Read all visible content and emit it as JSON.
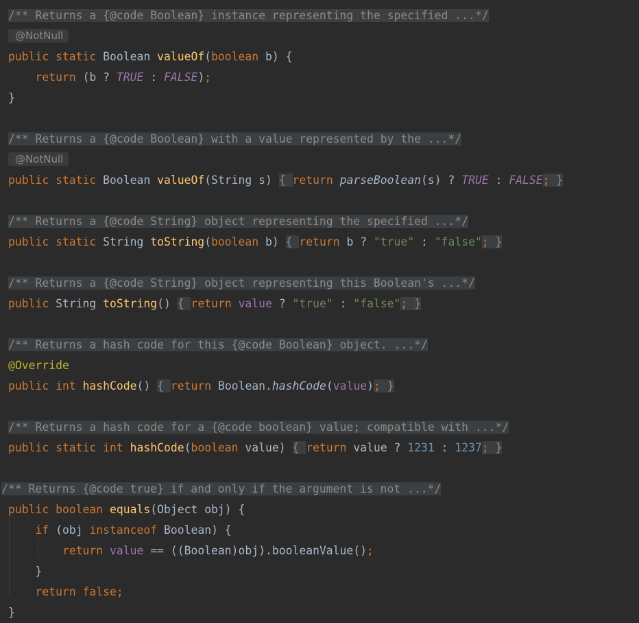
{
  "editor": {
    "lines": [
      {
        "tokens": [
          {
            "c": "fold-comment",
            "t": "/** Returns a {@code Boolean} instance representing the specified ...*/"
          }
        ]
      },
      {
        "inlay": "@NotNull"
      },
      {
        "tokens": [
          {
            "c": "t-kw",
            "t": "public static "
          },
          {
            "c": "t-pl",
            "t": "Boolean "
          },
          {
            "c": "t-fn",
            "t": "valueOf"
          },
          {
            "c": "t-pl",
            "t": "("
          },
          {
            "c": "t-kw",
            "t": "boolean "
          },
          {
            "c": "t-pl",
            "t": "b) {"
          }
        ]
      },
      {
        "tokens": [
          {
            "c": "t-pl",
            "t": "    "
          },
          {
            "c": "t-kw",
            "t": "return "
          },
          {
            "c": "t-pl",
            "t": "(b ? "
          },
          {
            "c": "t-sfld",
            "t": "TRUE"
          },
          {
            "c": "t-pl",
            "t": " : "
          },
          {
            "c": "t-sfld",
            "t": "FALSE"
          },
          {
            "c": "t-pl",
            "t": ")"
          },
          {
            "c": "t-semi",
            "t": ";"
          }
        ]
      },
      {
        "tokens": [
          {
            "c": "t-pl",
            "t": "}"
          }
        ]
      },
      {
        "tokens": []
      },
      {
        "tokens": [
          {
            "c": "fold-comment",
            "t": "/** Returns a {@code Boolean} with a value represented by the ...*/"
          }
        ]
      },
      {
        "inlay": "@NotNull"
      },
      {
        "tokens": [
          {
            "c": "t-kw",
            "t": "public static "
          },
          {
            "c": "t-pl",
            "t": "Boolean "
          },
          {
            "c": "t-fn",
            "t": "valueOf"
          },
          {
            "c": "t-pl",
            "t": "(String s)"
          },
          {
            "c": "t-pl",
            "t": " "
          },
          {
            "c": "fold",
            "t": "{ "
          },
          {
            "c": "t-kw",
            "t": "return "
          },
          {
            "c": "t-sfn",
            "t": "parseBoolean"
          },
          {
            "c": "t-pl",
            "t": "(s) ? "
          },
          {
            "c": "t-sfld",
            "t": "TRUE"
          },
          {
            "c": "t-pl",
            "t": " : "
          },
          {
            "c": "t-sfld",
            "t": "FALSE"
          },
          {
            "c": "fold-semi",
            "t": ";"
          },
          {
            "c": "fold",
            "t": " }"
          }
        ]
      },
      {
        "tokens": []
      },
      {
        "tokens": [
          {
            "c": "fold-comment",
            "t": "/** Returns a {@code String} object representing the specified ...*/"
          }
        ]
      },
      {
        "tokens": [
          {
            "c": "t-kw",
            "t": "public static "
          },
          {
            "c": "t-pl",
            "t": "String "
          },
          {
            "c": "t-fn",
            "t": "toString"
          },
          {
            "c": "t-pl",
            "t": "("
          },
          {
            "c": "t-kw",
            "t": "boolean "
          },
          {
            "c": "t-pl",
            "t": "b)"
          },
          {
            "c": "t-pl",
            "t": " "
          },
          {
            "c": "fold",
            "t": "{ "
          },
          {
            "c": "t-kw",
            "t": "return "
          },
          {
            "c": "t-pl",
            "t": "b ? "
          },
          {
            "c": "t-str",
            "t": "\"true\""
          },
          {
            "c": "t-pl",
            "t": " : "
          },
          {
            "c": "t-str",
            "t": "\"false\""
          },
          {
            "c": "fold-semi",
            "t": ";"
          },
          {
            "c": "fold",
            "t": " }"
          }
        ]
      },
      {
        "tokens": []
      },
      {
        "tokens": [
          {
            "c": "fold-comment",
            "t": "/** Returns a {@code String} object representing this Boolean's ...*/"
          }
        ]
      },
      {
        "tokens": [
          {
            "c": "t-kw",
            "t": "public "
          },
          {
            "c": "t-pl",
            "t": "String "
          },
          {
            "c": "t-fn",
            "t": "toString"
          },
          {
            "c": "t-pl",
            "t": "()"
          },
          {
            "c": "t-pl",
            "t": " "
          },
          {
            "c": "fold",
            "t": "{ "
          },
          {
            "c": "t-kw",
            "t": "return "
          },
          {
            "c": "t-fld",
            "t": "value"
          },
          {
            "c": "t-pl",
            "t": " ? "
          },
          {
            "c": "t-str",
            "t": "\"true\""
          },
          {
            "c": "t-pl",
            "t": " : "
          },
          {
            "c": "t-str",
            "t": "\"false\""
          },
          {
            "c": "fold-semi",
            "t": ";"
          },
          {
            "c": "fold",
            "t": " }"
          }
        ]
      },
      {
        "tokens": []
      },
      {
        "tokens": [
          {
            "c": "fold-comment",
            "t": "/** Returns a hash code for this {@code Boolean} object. ...*/"
          }
        ]
      },
      {
        "tokens": [
          {
            "c": "t-ann",
            "t": "@Override"
          }
        ]
      },
      {
        "tokens": [
          {
            "c": "t-kw",
            "t": "public int "
          },
          {
            "c": "t-fn",
            "t": "hashCode"
          },
          {
            "c": "t-pl",
            "t": "()"
          },
          {
            "c": "t-pl",
            "t": " "
          },
          {
            "c": "fold",
            "t": "{ "
          },
          {
            "c": "t-kw",
            "t": "return "
          },
          {
            "c": "t-pl",
            "t": "Boolean."
          },
          {
            "c": "t-sfn",
            "t": "hashCode"
          },
          {
            "c": "t-pl",
            "t": "("
          },
          {
            "c": "t-fld",
            "t": "value"
          },
          {
            "c": "t-pl",
            "t": ")"
          },
          {
            "c": "fold-semi",
            "t": ";"
          },
          {
            "c": "fold",
            "t": " }"
          }
        ]
      },
      {
        "tokens": []
      },
      {
        "tokens": [
          {
            "c": "fold-comment",
            "t": "/** Returns a hash code for a {@code boolean} value; compatible with ...*/"
          }
        ]
      },
      {
        "tokens": [
          {
            "c": "t-kw",
            "t": "public static int "
          },
          {
            "c": "t-fn",
            "t": "hashCode"
          },
          {
            "c": "t-pl",
            "t": "("
          },
          {
            "c": "t-kw",
            "t": "boolean "
          },
          {
            "c": "t-pl",
            "t": "value)"
          },
          {
            "c": "t-pl",
            "t": " "
          },
          {
            "c": "fold",
            "t": "{ "
          },
          {
            "c": "t-kw",
            "t": "return "
          },
          {
            "c": "t-pl",
            "t": "value ? "
          },
          {
            "c": "t-num",
            "t": "1231"
          },
          {
            "c": "t-pl",
            "t": " : "
          },
          {
            "c": "t-num",
            "t": "1237"
          },
          {
            "c": "fold-semi",
            "t": ";"
          },
          {
            "c": "fold",
            "t": " }"
          }
        ]
      },
      {
        "tokens": []
      },
      {
        "outdent": true,
        "tokens": [
          {
            "c": "fold-comment",
            "t": "/** Returns {@code true} if and only if the argument is not ...*/"
          }
        ]
      },
      {
        "tokens": [
          {
            "c": "t-kw",
            "t": "public boolean "
          },
          {
            "c": "t-fn",
            "t": "equals"
          },
          {
            "c": "t-pl",
            "t": "(Object obj) {"
          }
        ]
      },
      {
        "tokens": [
          {
            "c": "t-pl",
            "t": "    "
          },
          {
            "c": "t-kw",
            "t": "if "
          },
          {
            "c": "t-pl",
            "t": "(obj "
          },
          {
            "c": "t-kw",
            "t": "instanceof "
          },
          {
            "c": "t-pl",
            "t": "Boolean) {"
          }
        ]
      },
      {
        "tokens": [
          {
            "c": "t-pl",
            "t": "        "
          },
          {
            "c": "t-kw",
            "t": "return "
          },
          {
            "c": "t-fld",
            "t": "value"
          },
          {
            "c": "t-pl",
            "t": " == ((Boolean)obj).booleanValue()"
          },
          {
            "c": "t-semi",
            "t": ";"
          }
        ]
      },
      {
        "tokens": [
          {
            "c": "t-pl",
            "t": "    }"
          }
        ]
      },
      {
        "tokens": [
          {
            "c": "t-pl",
            "t": "    "
          },
          {
            "c": "t-kw",
            "t": "return false"
          },
          {
            "c": "t-semi",
            "t": ";"
          }
        ]
      },
      {
        "tokens": [
          {
            "c": "t-pl",
            "t": "}"
          }
        ]
      }
    ]
  }
}
